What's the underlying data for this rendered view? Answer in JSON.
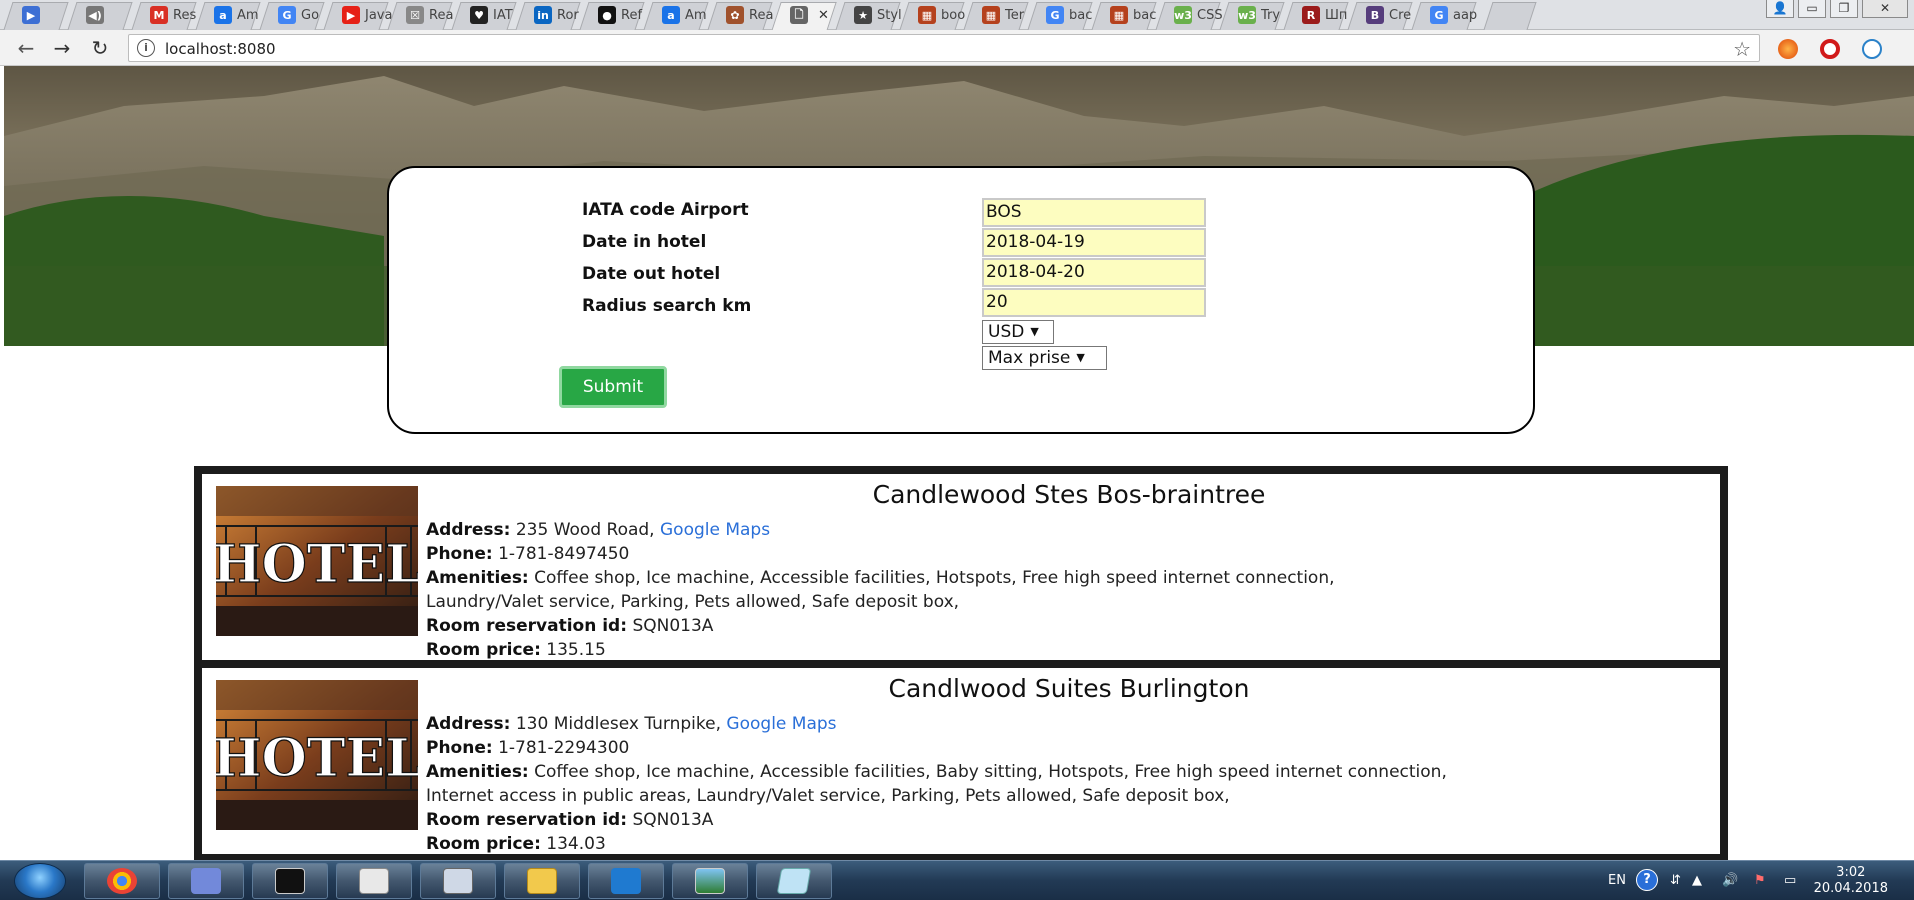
{
  "browser": {
    "tabs": [
      {
        "label": "",
        "color": "#3d6fd4",
        "glyph": "▶"
      },
      {
        "label": "",
        "color": "#777777",
        "glyph": "◀)"
      },
      {
        "label": "Res",
        "color": "#d93025",
        "glyph": "M"
      },
      {
        "label": "Am",
        "color": "#1a73e8",
        "glyph": "a"
      },
      {
        "label": "Go",
        "color": "#4285f4",
        "glyph": "G"
      },
      {
        "label": "Java",
        "color": "#e62117",
        "glyph": "▶"
      },
      {
        "label": "Rea",
        "color": "#888888",
        "glyph": "☒"
      },
      {
        "label": "IAT",
        "color": "#222222",
        "glyph": "♥"
      },
      {
        "label": "Ror",
        "color": "#0a66c2",
        "glyph": "in"
      },
      {
        "label": "Ref",
        "color": "#111111",
        "glyph": "●"
      },
      {
        "label": "Am",
        "color": "#1a73e8",
        "glyph": "a"
      },
      {
        "label": "Rea",
        "color": "#a0522d",
        "glyph": "✿"
      },
      {
        "label": "",
        "color": "#666666",
        "glyph": "🗋",
        "active": true
      },
      {
        "label": "Styl",
        "color": "#444444",
        "glyph": "★"
      },
      {
        "label": "boo",
        "color": "#b5411d",
        "glyph": "▦"
      },
      {
        "label": "Ter",
        "color": "#b5411d",
        "glyph": "▦"
      },
      {
        "label": "bac",
        "color": "#4285f4",
        "glyph": "G"
      },
      {
        "label": "bac",
        "color": "#b5411d",
        "glyph": "▦"
      },
      {
        "label": "CSS",
        "color": "#6ab04c",
        "glyph": "w3"
      },
      {
        "label": "Try",
        "color": "#6ab04c",
        "glyph": "w3"
      },
      {
        "label": "Шп",
        "color": "#9b1b1b",
        "glyph": "R"
      },
      {
        "label": "Cre",
        "color": "#563d7c",
        "glyph": "B"
      },
      {
        "label": "aap",
        "color": "#4285f4",
        "glyph": "G"
      }
    ],
    "url": "localhost:8080"
  },
  "form": {
    "iata_label": "IATA code Airport",
    "iata_value": "BOS",
    "date_in_label": "Date in hotel",
    "date_in_value": "2018-04-19",
    "date_out_label": "Date out hotel",
    "date_out_value": "2018-04-20",
    "radius_label": "Radius search km",
    "radius_value": "20",
    "currency_selected": "USD",
    "sort_selected": "Max prise",
    "submit_label": "Submit"
  },
  "hotels": [
    {
      "name": "Candlewood Stes Bos-braintree",
      "address_label": "Address:",
      "address": "235 Wood Road,",
      "maps_label": "Google Maps",
      "phone_label": "Phone:",
      "phone": "1-781-8497450",
      "amenities_label": "Amenities:",
      "amenities_line1": "Coffee shop, Ice machine, Accessible facilities, Hotspots, Free high speed internet connection,",
      "amenities_line2": "Laundry/Valet service, Parking, Pets allowed, Safe deposit box,",
      "reservation_label": "Room reservation id:",
      "reservation_id": "SQN013A",
      "price_label": "Room price:",
      "price": "135.15",
      "image_text": "HOTEL"
    },
    {
      "name": "Candlwood Suites Burlington",
      "address_label": "Address:",
      "address": "130 Middlesex Turnpike,",
      "maps_label": "Google Maps",
      "phone_label": "Phone:",
      "phone": "1-781-2294300",
      "amenities_label": "Amenities:",
      "amenities_line1": "Coffee shop, Ice machine, Accessible facilities, Baby sitting, Hotspots, Free high speed internet connection,",
      "amenities_line2": "Internet access in public areas, Laundry/Valet service, Parking, Pets allowed, Safe deposit box,",
      "reservation_label": "Room reservation id:",
      "reservation_id": "SQN013A",
      "price_label": "Room price:",
      "price": "134.03",
      "image_text": "HOTEL"
    }
  ],
  "taskbar": {
    "apps": [
      "chrome",
      "discord",
      "command-prompt",
      "text-editor",
      "calculator",
      "file-explorer",
      "visual-studio-code",
      "image-viewer",
      "notepad"
    ],
    "language": "EN",
    "time": "3:02",
    "date": "20.04.2018"
  }
}
